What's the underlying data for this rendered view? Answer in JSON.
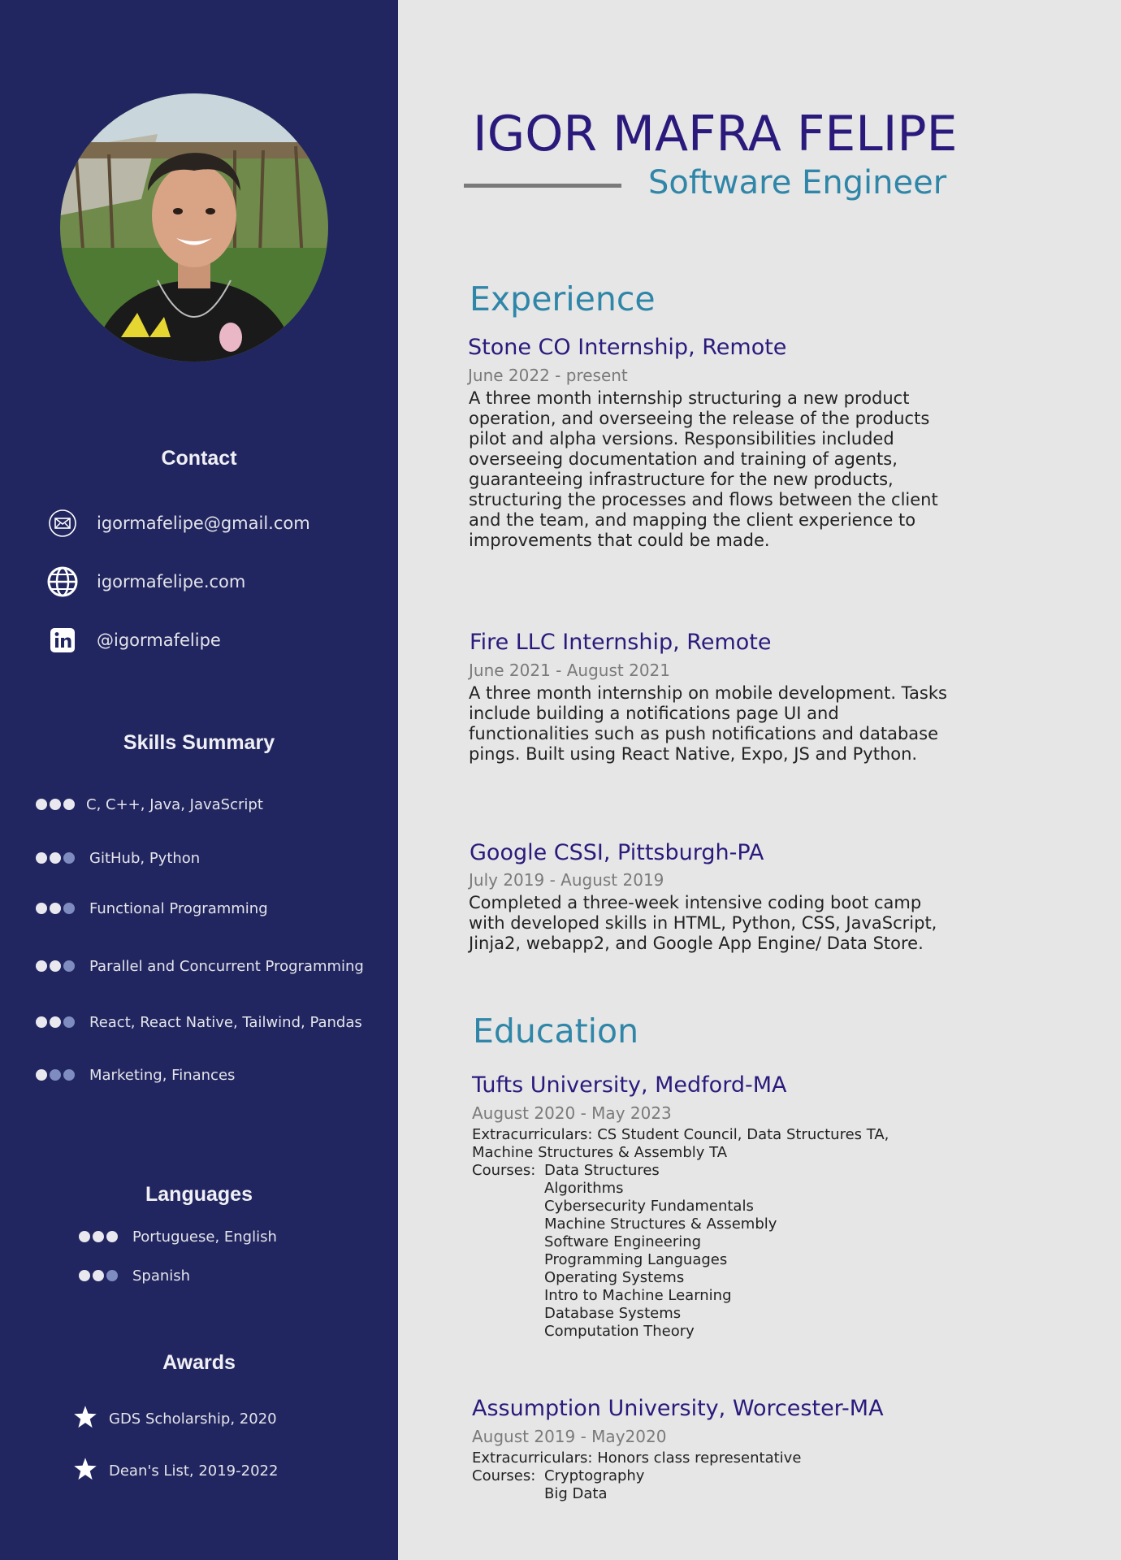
{
  "sidebar": {
    "contact_heading": "Contact",
    "contacts": [
      {
        "icon": "envelope-icon",
        "text": "igormafelipe@gmail.com"
      },
      {
        "icon": "globe-icon",
        "text": "igormafelipe.com"
      },
      {
        "icon": "linkedin-icon",
        "text": "@igormafelipe"
      }
    ],
    "skills_heading": "Skills Summary",
    "skills": [
      {
        "text": "C, C++, Java, JavaScript",
        "level": 3
      },
      {
        "text": "GitHub, Python",
        "level": 2
      },
      {
        "text": "Functional Programming",
        "level": 2
      },
      {
        "text": "Parallel and Concurrent Programming",
        "level": 2
      },
      {
        "text": "React, React Native, Tailwind, Pandas",
        "level": 2
      },
      {
        "text": "Marketing, Finances",
        "level": 1
      }
    ],
    "languages_heading": "Languages",
    "languages": [
      {
        "text": "Portuguese, English",
        "level": 3
      },
      {
        "text": "Spanish",
        "level": 2
      }
    ],
    "awards_heading": "Awards",
    "awards": [
      {
        "icon": "star-icon",
        "text": "GDS Scholarship, 2020"
      },
      {
        "icon": "star-icon",
        "text": "Dean's List, 2019-2022"
      }
    ]
  },
  "header": {
    "name": "IGOR MAFRA FELIPE",
    "role": "Software Engineer"
  },
  "experience": {
    "heading": "Experience",
    "jobs": [
      {
        "title": "Stone CO Internship, Remote",
        "date": "June 2022 - present",
        "lines": [
          "A three month internship structuring a new product",
          "operation, and overseeing the release of the products",
          "pilot and alpha versions. Responsibilities included",
          "overseeing documentation and training of agents,",
          "guaranteeing infrastructure for the new products,",
          "structuring the processes and flows between the client",
          "and the team, and mapping the client experience to",
          "improvements that could be made."
        ]
      },
      {
        "title": "Fire LLC Internship, Remote",
        "date": "June 2021 - August 2021",
        "lines": [
          "A three month internship on mobile development. Tasks",
          "include building a notifications page UI and",
          "functionalities such as push notifications and database",
          "pings. Built using React Native, Expo, JS and Python."
        ]
      },
      {
        "title": "Google CSSI, Pittsburgh-PA",
        "date": "July 2019 - August 2019",
        "lines": [
          "Completed a three-week intensive coding boot camp",
          "with developed skills in HTML, Python, CSS, JavaScript,",
          "Jinja2, webapp2, and Google App Engine/ Data Store."
        ]
      }
    ]
  },
  "education": {
    "heading": "Education",
    "schools": [
      {
        "title": "Tufts University, Medford-MA",
        "date": "August 2020 - May 2023",
        "extra_lines": [
          "Extracurriculars: CS Student Council, Data Structures TA,",
          "Machine Structures & Assembly TA"
        ],
        "courses_label": "Courses:",
        "courses": [
          "Data Structures",
          "Algorithms",
          "Cybersecurity Fundamentals",
          "Machine Structures & Assembly",
          "Software Engineering",
          "Programming Languages",
          "Operating Systems",
          "Intro to Machine Learning",
          "Database Systems",
          "Computation Theory"
        ]
      },
      {
        "title": "Assumption University, Worcester-MA",
        "date": "August 2019 - May2020",
        "extra_lines": [
          "Extracurriculars: Honors class representative"
        ],
        "courses_label": "Courses:",
        "courses": [
          "Cryptography",
          "Big Data"
        ]
      }
    ]
  }
}
